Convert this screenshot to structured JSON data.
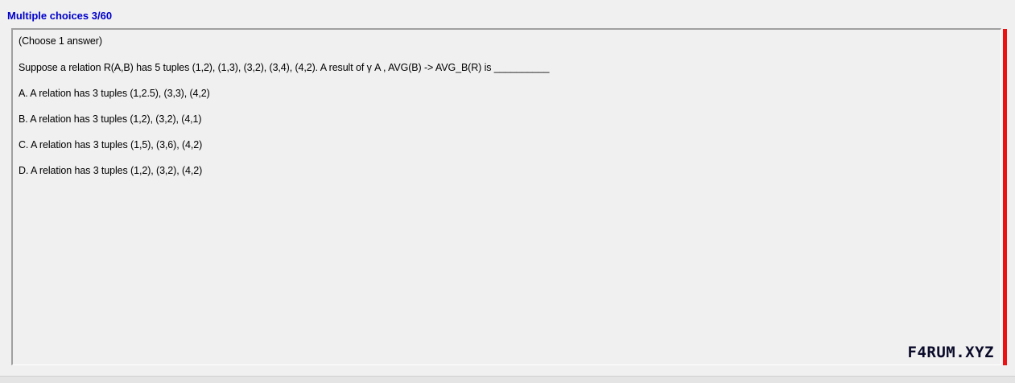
{
  "header": {
    "title": "Multiple choices 3/60"
  },
  "question": {
    "instruction": "(Choose 1 answer)",
    "text": "Suppose a relation R(A,B) has 5 tuples (1,2), (1,3), (3,2), (3,4), (4,2). A result of γ A , AVG(B) -> AVG_B(R) is __________",
    "options": [
      {
        "label": "A.  A relation has 3 tuples (1,2.5), (3,3), (4,2)"
      },
      {
        "label": "B.  A relation has 3 tuples (1,2), (3,2), (4,1)"
      },
      {
        "label": "C.  A relation has 3 tuples (1,5), (3,6), (4,2)"
      },
      {
        "label": "D.  A relation has 3 tuples (1,2), (3,2), (4,2)"
      }
    ]
  },
  "watermark": "F4RUM.XYZ",
  "colors": {
    "title": "#0000cc",
    "accent_bar": "#ee1111",
    "background": "#f0f0f0"
  }
}
